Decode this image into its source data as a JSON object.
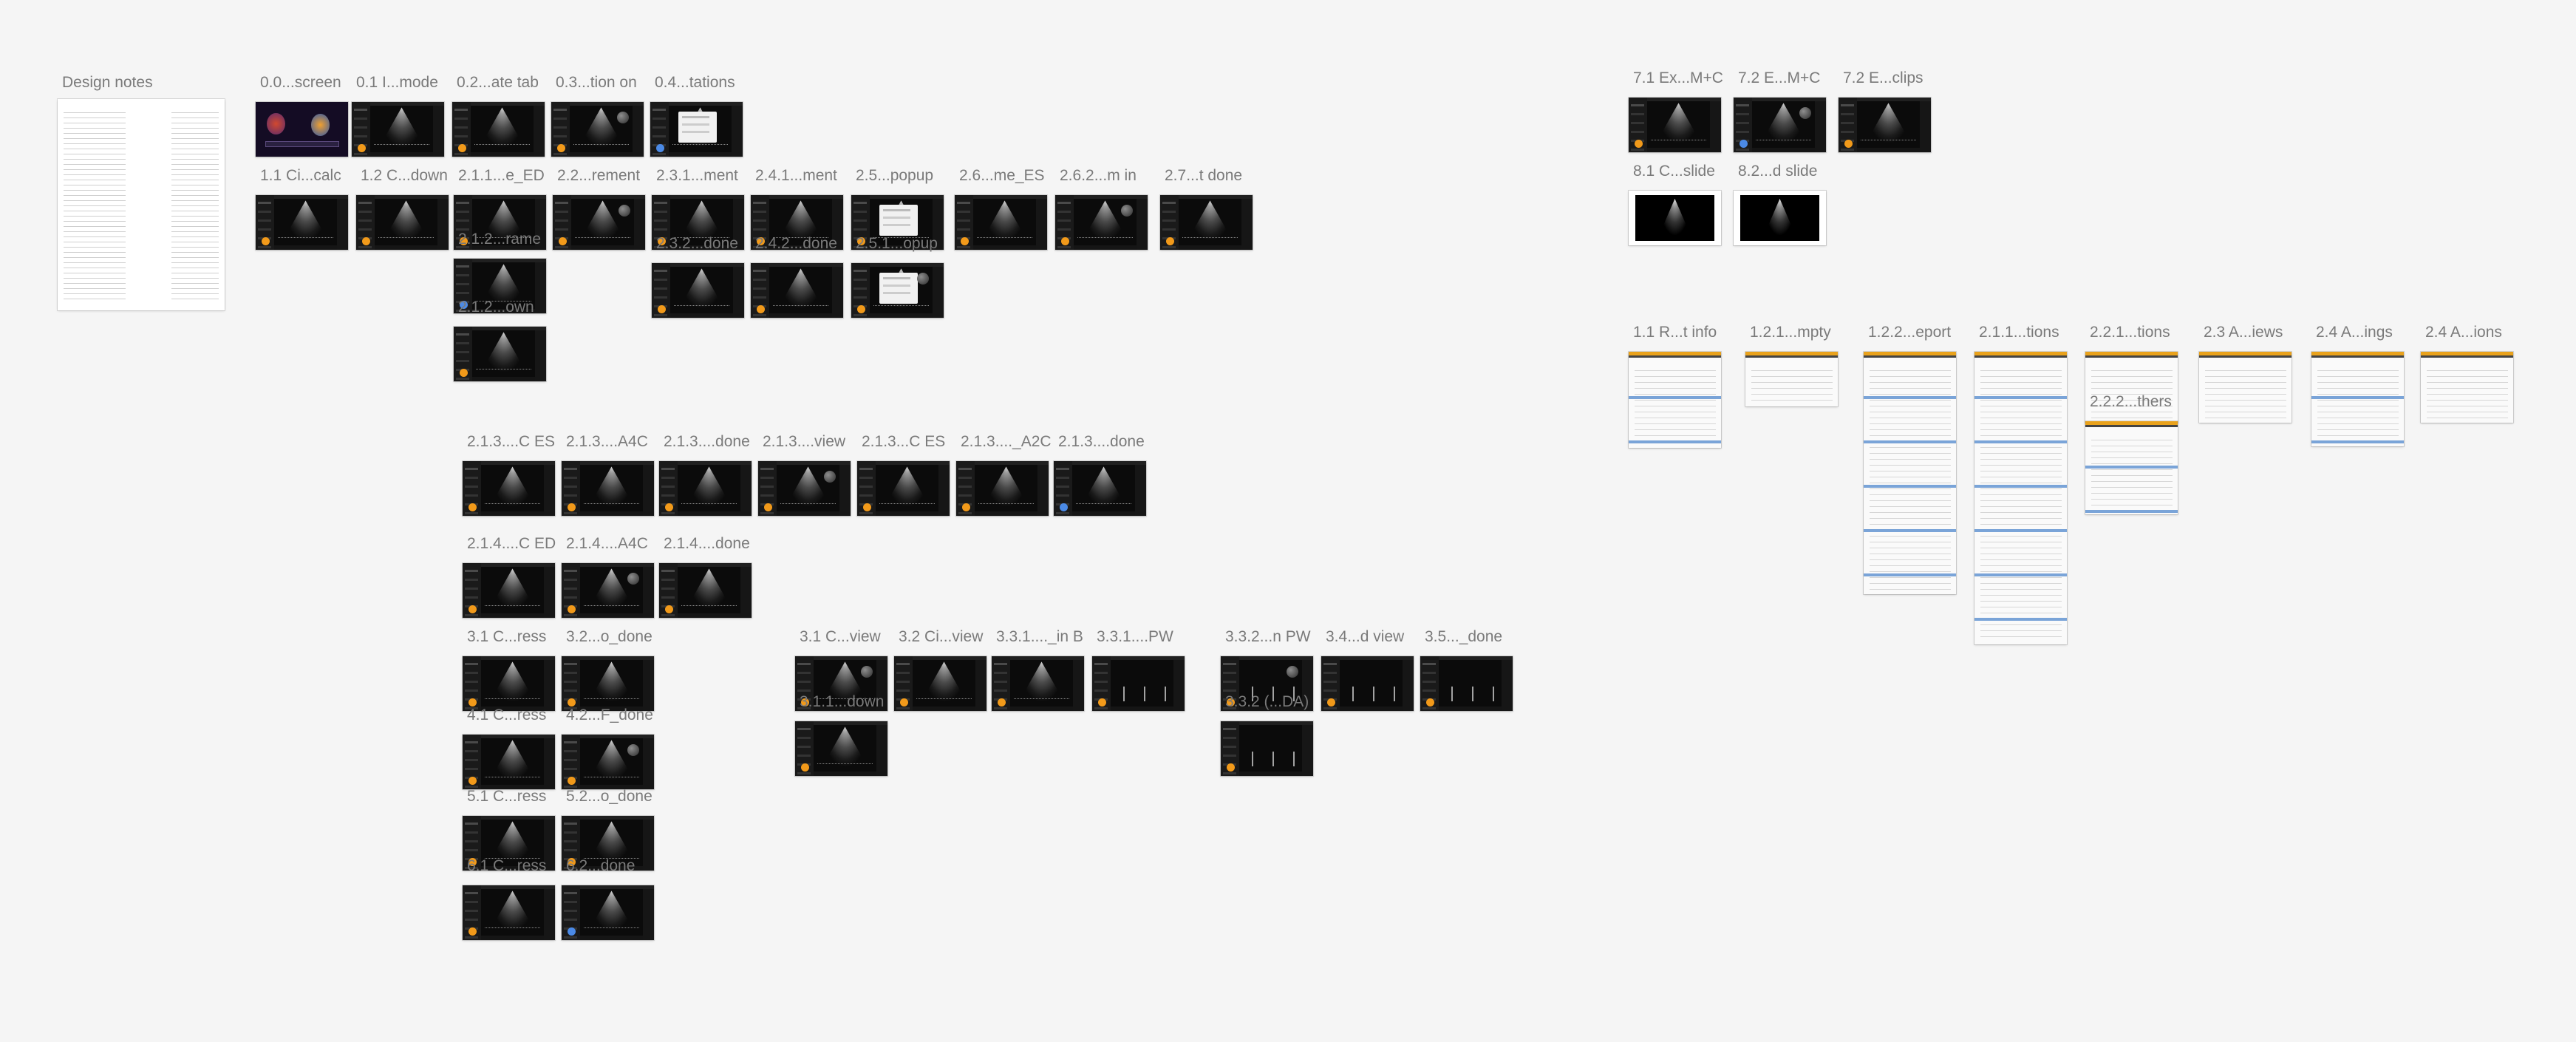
{
  "canvas": {
    "background": "#f5f5f5"
  },
  "notes": {
    "label": "Design notes"
  },
  "frames": [
    {
      "label": "0.0...screen",
      "kind": "colorful"
    },
    {
      "label": "0.1 I...mode",
      "kind": "dark"
    },
    {
      "label": "0.2...ate tab",
      "kind": "dark"
    },
    {
      "label": "0.3...tion on",
      "kind": "dark"
    },
    {
      "label": "0.4...tations",
      "kind": "dialog"
    },
    {
      "label": "1.1 Ci...calc",
      "kind": "dark"
    },
    {
      "label": "1.2 C...down",
      "kind": "dark"
    },
    {
      "label": "2.1.1...e_ED",
      "kind": "dark"
    },
    {
      "label": "2.2...rement",
      "kind": "dark"
    },
    {
      "label": "2.3.1...ment",
      "kind": "dark"
    },
    {
      "label": "2.4.1...ment",
      "kind": "dark"
    },
    {
      "label": "2.5...popup",
      "kind": "dialog"
    },
    {
      "label": "2.6...me_ES",
      "kind": "dark"
    },
    {
      "label": "2.6.2...m in",
      "kind": "dark"
    },
    {
      "label": "2.7...t done",
      "kind": "dark"
    },
    {
      "label": "2.1.2...rame",
      "kind": "dark"
    },
    {
      "label": "2.3.2...done",
      "kind": "dark"
    },
    {
      "label": "2.4.2...done",
      "kind": "dark"
    },
    {
      "label": "2.5.1...opup",
      "kind": "dialog"
    },
    {
      "label": "2.1.2...own",
      "kind": "dark"
    },
    {
      "label": "2.1.3....C ES",
      "kind": "dark"
    },
    {
      "label": "2.1.3....A4C",
      "kind": "dark"
    },
    {
      "label": "2.1.3....done",
      "kind": "dark"
    },
    {
      "label": "2.1.3....view",
      "kind": "dark"
    },
    {
      "label": "2.1.3...C ES",
      "kind": "dark"
    },
    {
      "label": "2.1.3...._A2C",
      "kind": "dark"
    },
    {
      "label": "2.1.3....done",
      "kind": "dark"
    },
    {
      "label": "2.1.4....C ED",
      "kind": "dark"
    },
    {
      "label": "2.1.4....A4C",
      "kind": "dark"
    },
    {
      "label": "2.1.4....done",
      "kind": "dark"
    },
    {
      "label": "3.1 C...ress",
      "kind": "dark"
    },
    {
      "label": "3.2...o_done",
      "kind": "dark"
    },
    {
      "label": "4.1 C...ress",
      "kind": "dark"
    },
    {
      "label": "4.2...F_done",
      "kind": "dark"
    },
    {
      "label": "5.1 C...ress",
      "kind": "dark"
    },
    {
      "label": "5.2...o_done",
      "kind": "dark"
    },
    {
      "label": "6.1 C...ress",
      "kind": "dark"
    },
    {
      "label": "6.2...done",
      "kind": "dark"
    },
    {
      "label": "3.1 C...view",
      "kind": "dark"
    },
    {
      "label": "3.2 Ci...view",
      "kind": "dark"
    },
    {
      "label": "3.3.1...._in B",
      "kind": "dark"
    },
    {
      "label": "3.3.1....PW",
      "kind": "wave"
    },
    {
      "label": "3.1.1...down",
      "kind": "dark"
    },
    {
      "label": "3.3.2...n PW",
      "kind": "wave"
    },
    {
      "label": "3.4...d view",
      "kind": "wave"
    },
    {
      "label": "3.5..._done",
      "kind": "wave"
    },
    {
      "label": "3.3.2 (...DA)",
      "kind": "wave"
    },
    {
      "label": "7.1 Ex...M+C",
      "kind": "dark"
    },
    {
      "label": "7.2 E...M+C",
      "kind": "dark"
    },
    {
      "label": "7.2 E...clips",
      "kind": "dark"
    },
    {
      "label": "8.1 C...slide",
      "kind": "slide"
    },
    {
      "label": "8.2...d slide",
      "kind": "slide"
    },
    {
      "label": "1.1 R...t info",
      "kind": "report"
    },
    {
      "label": "1.2.1...mpty",
      "kind": "report"
    },
    {
      "label": "1.2.2...eport",
      "kind": "report"
    },
    {
      "label": "2.1.1...tions",
      "kind": "report"
    },
    {
      "label": "2.2.1...tions",
      "kind": "report"
    },
    {
      "label": "2.2.2...thers",
      "kind": "report"
    },
    {
      "label": "2.3 A...iews",
      "kind": "report"
    },
    {
      "label": "2.4 A...ings",
      "kind": "report"
    },
    {
      "label": "2.4 A...ions",
      "kind": "report"
    }
  ]
}
